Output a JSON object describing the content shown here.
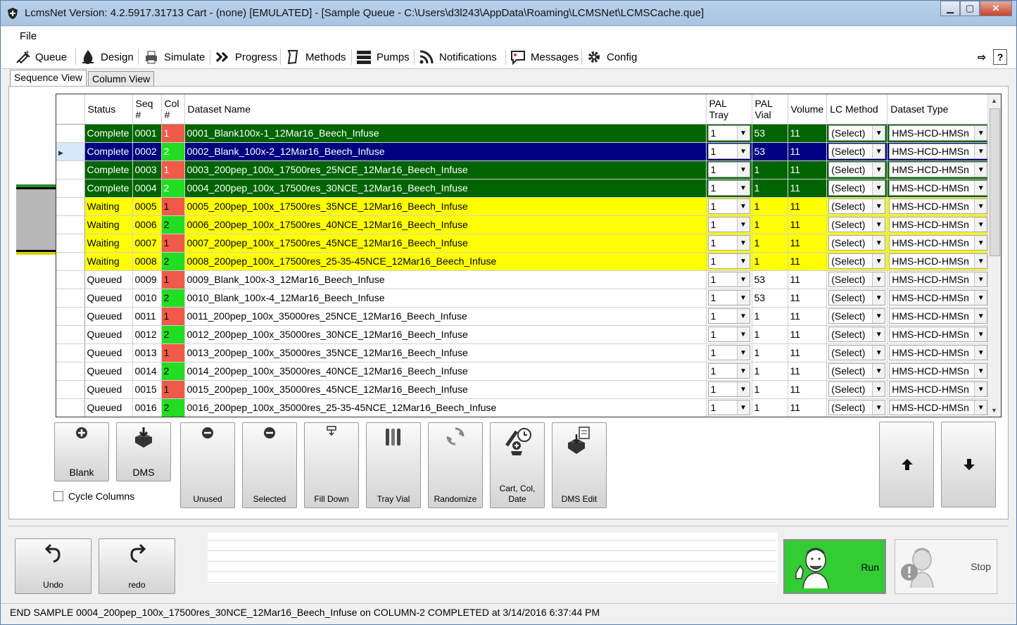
{
  "window": {
    "title": "LcmsNet Version: 4.2.5917.31713 Cart - (none) [EMULATED]  - [Sample Queue - C:\\Users\\d3l243\\AppData\\Roaming\\LCMSNet\\LCMSCache.que]"
  },
  "menu": {
    "file": "File"
  },
  "toolbar": {
    "queue": "Queue",
    "design": "Design",
    "simulate": "Simulate",
    "progress": "Progress",
    "methods": "Methods",
    "pumps": "Pumps",
    "notifications": "Notifications",
    "messages": "Messages",
    "config": "Config",
    "help": "?"
  },
  "tabs": {
    "sequence": "Sequence View",
    "column": "Column View"
  },
  "grid": {
    "headers": {
      "status": "Status",
      "seq": "Seq #",
      "col": "Col #",
      "dataset": "Dataset Name",
      "pal_tray": "PAL Tray",
      "pal_vial": "PAL Vial",
      "volume": "Volume",
      "lc_method": "LC Method",
      "dataset_type": "Dataset Type"
    },
    "rows": [
      {
        "status": "Complete",
        "seq": "0001",
        "col": "1",
        "name": "0001_Blank100x-1_12Mar16_Beech_Infuse",
        "tray": "1",
        "vial": "53",
        "vol": "11",
        "method": "(Select)",
        "dtype": "HMS-HCD-HMSn"
      },
      {
        "status": "Complete",
        "seq": "0002",
        "col": "2",
        "name": "0002_Blank_100x-2_12Mar16_Beech_Infuse",
        "tray": "1",
        "vial": "53",
        "vol": "11",
        "method": "(Select)",
        "dtype": "HMS-HCD-HMSn"
      },
      {
        "status": "Complete",
        "seq": "0003",
        "col": "1",
        "name": "0003_200pep_100x_17500res_25NCE_12Mar16_Beech_Infuse",
        "tray": "1",
        "vial": "1",
        "vol": "11",
        "method": "(Select)",
        "dtype": "HMS-HCD-HMSn"
      },
      {
        "status": "Complete",
        "seq": "0004",
        "col": "2",
        "name": "0004_200pep_100x_17500res_30NCE_12Mar16_Beech_Infuse",
        "tray": "1",
        "vial": "1",
        "vol": "11",
        "method": "(Select)",
        "dtype": "HMS-HCD-HMSn"
      },
      {
        "status": "Waiting",
        "seq": "0005",
        "col": "1",
        "name": "0005_200pep_100x_17500res_35NCE_12Mar16_Beech_Infuse",
        "tray": "1",
        "vial": "1",
        "vol": "11",
        "method": "(Select)",
        "dtype": "HMS-HCD-HMSn"
      },
      {
        "status": "Waiting",
        "seq": "0006",
        "col": "2",
        "name": "0006_200pep_100x_17500res_40NCE_12Mar16_Beech_Infuse",
        "tray": "1",
        "vial": "1",
        "vol": "11",
        "method": "(Select)",
        "dtype": "HMS-HCD-HMSn"
      },
      {
        "status": "Waiting",
        "seq": "0007",
        "col": "1",
        "name": "0007_200pep_100x_17500res_45NCE_12Mar16_Beech_Infuse",
        "tray": "1",
        "vial": "1",
        "vol": "11",
        "method": "(Select)",
        "dtype": "HMS-HCD-HMSn"
      },
      {
        "status": "Waiting",
        "seq": "0008",
        "col": "2",
        "name": "0008_200pep_100x_17500res_25-35-45NCE_12Mar16_Beech_Infuse",
        "tray": "1",
        "vial": "1",
        "vol": "11",
        "method": "(Select)",
        "dtype": "HMS-HCD-HMSn"
      },
      {
        "status": "Queued",
        "seq": "0009",
        "col": "1",
        "name": "0009_Blank_100x-3_12Mar16_Beech_Infuse",
        "tray": "1",
        "vial": "53",
        "vol": "11",
        "method": "(Select)",
        "dtype": "HMS-HCD-HMSn"
      },
      {
        "status": "Queued",
        "seq": "0010",
        "col": "2",
        "name": "0010_Blank_100x-4_12Mar16_Beech_Infuse",
        "tray": "1",
        "vial": "53",
        "vol": "11",
        "method": "(Select)",
        "dtype": "HMS-HCD-HMSn"
      },
      {
        "status": "Queued",
        "seq": "0011",
        "col": "1",
        "name": "0011_200pep_100x_35000res_25NCE_12Mar16_Beech_Infuse",
        "tray": "1",
        "vial": "1",
        "vol": "11",
        "method": "(Select)",
        "dtype": "HMS-HCD-HMSn"
      },
      {
        "status": "Queued",
        "seq": "0012",
        "col": "2",
        "name": "0012_200pep_100x_35000res_30NCE_12Mar16_Beech_Infuse",
        "tray": "1",
        "vial": "1",
        "vol": "11",
        "method": "(Select)",
        "dtype": "HMS-HCD-HMSn"
      },
      {
        "status": "Queued",
        "seq": "0013",
        "col": "1",
        "name": "0013_200pep_100x_35000res_35NCE_12Mar16_Beech_Infuse",
        "tray": "1",
        "vial": "1",
        "vol": "11",
        "method": "(Select)",
        "dtype": "HMS-HCD-HMSn"
      },
      {
        "status": "Queued",
        "seq": "0014",
        "col": "2",
        "name": "0014_200pep_100x_35000res_40NCE_12Mar16_Beech_Infuse",
        "tray": "1",
        "vial": "1",
        "vol": "11",
        "method": "(Select)",
        "dtype": "HMS-HCD-HMSn"
      },
      {
        "status": "Queued",
        "seq": "0015",
        "col": "1",
        "name": "0015_200pep_100x_35000res_45NCE_12Mar16_Beech_Infuse",
        "tray": "1",
        "vial": "1",
        "vol": "11",
        "method": "(Select)",
        "dtype": "HMS-HCD-HMSn"
      },
      {
        "status": "Queued",
        "seq": "0016",
        "col": "2",
        "name": "0016_200pep_100x_35000res_25-35-45NCE_12Mar16_Beech_Infuse",
        "tray": "1",
        "vial": "1",
        "vol": "11",
        "method": "(Select)",
        "dtype": "HMS-HCD-HMSn"
      }
    ],
    "selected_index": 1
  },
  "buttons": {
    "blank": "Blank",
    "dms": "DMS",
    "unused": "Unused",
    "selected": "Selected",
    "fill_down": "Fill Down",
    "tray_vial": "Tray Vial",
    "randomize": "Randomize",
    "cart_col_date": "Cart, Col, Date",
    "dms_edit": "DMS Edit",
    "cycle_columns": "Cycle Columns",
    "undo": "Undo",
    "redo": "redo",
    "run": "Run",
    "stop": "Stop"
  },
  "status_message": "END SAMPLE 0004_200pep_100x_17500res_30NCE_12Mar16_Beech_Infuse on COLUMN-2 COMPLETED at 3/14/2016 6:37:44 PM",
  "colors": {
    "complete": "#006400",
    "selected": "#000080",
    "waiting": "#ffff00",
    "col1": "#f05a48",
    "col2": "#22dd22",
    "run": "#33cc33"
  }
}
